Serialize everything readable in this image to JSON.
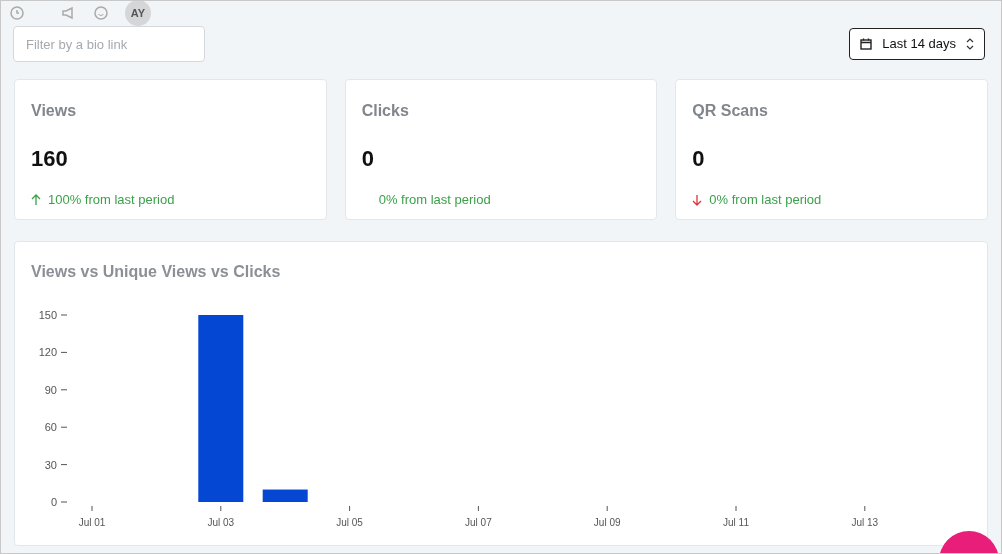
{
  "topbar": {
    "avatar": "AY"
  },
  "filter": {
    "placeholder": "Filter by a bio link"
  },
  "date_range": {
    "label": "Last 14 days"
  },
  "stats": [
    {
      "title": "Views",
      "value": "160",
      "kind": "up",
      "change": "100% from last period"
    },
    {
      "title": "Clicks",
      "value": "0",
      "kind": "none",
      "change": "0% from last period"
    },
    {
      "title": "QR Scans",
      "value": "0",
      "kind": "down",
      "change": "0% from last period"
    }
  ],
  "chart": {
    "title": "Views vs Unique Views vs Clicks",
    "chart_data": {
      "type": "bar",
      "categories": [
        "Jul 01",
        null,
        "Jul 03",
        null,
        "Jul 05",
        null,
        "Jul 07",
        null,
        "Jul 09",
        null,
        "Jul 11",
        null,
        "Jul 13",
        null
      ],
      "ylim": [
        0,
        150
      ],
      "yticks": [
        0,
        30,
        60,
        90,
        120,
        150
      ],
      "series": [
        {
          "color": "#0447d2",
          "values": [
            0,
            0,
            150,
            10,
            0,
            0,
            0,
            0,
            0,
            0,
            0,
            0,
            0,
            0
          ]
        }
      ]
    }
  }
}
